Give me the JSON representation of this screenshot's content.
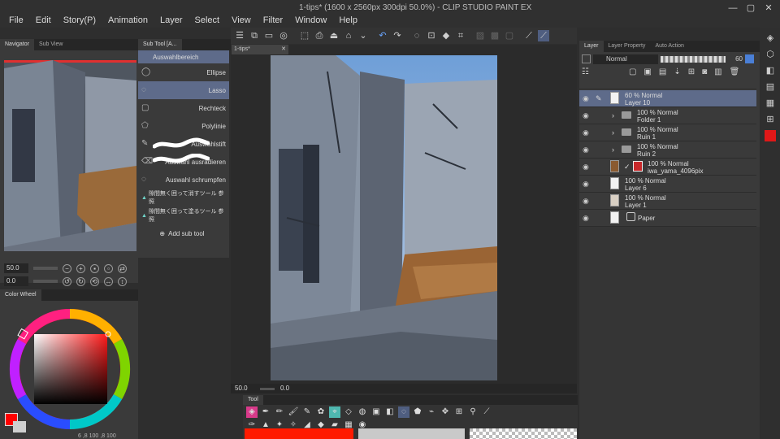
{
  "window": {
    "title": "1-tips* (1600 x 2560px 300dpi 50.0%) - CLIP STUDIO PAINT EX",
    "controls": [
      "—",
      "▢",
      "✕"
    ]
  },
  "menu": [
    "File",
    "Edit",
    "Story(P)",
    "Animation",
    "Layer",
    "Select",
    "View",
    "Filter",
    "Window",
    "Help"
  ],
  "navigator": {
    "tabs": [
      "Navigator",
      "Sub View"
    ],
    "zoom_value": "50.0",
    "rotate_value": "0.0"
  },
  "subtool": {
    "tab": "Sub Tool [A...",
    "header": "Auswahlbereich",
    "items": [
      {
        "label": "Ellipse",
        "icon": "ellipse-icon",
        "selected": false
      },
      {
        "label": "Lasso",
        "icon": "lasso-icon",
        "selected": true
      },
      {
        "label": "Rechteck",
        "icon": "rectangle-icon",
        "selected": false
      },
      {
        "label": "Polylinie",
        "icon": "polyline-icon",
        "selected": false
      },
      {
        "label": "Auswahlstift",
        "icon": "selection-pen-icon",
        "selected": false
      },
      {
        "label": "Auswahl ausradieren",
        "icon": "selection-eraser-icon",
        "selected": false
      },
      {
        "label": "Auswahl schrumpfen",
        "icon": "shrink-selection-icon",
        "selected": false
      },
      {
        "label": "隙間無く囲って消すツール 参照",
        "icon": "gap-fill-erase-icon",
        "selected": false
      },
      {
        "label": "隙間無く囲って塗るツール 参照",
        "icon": "gap-fill-paint-icon",
        "selected": false
      }
    ],
    "add_label": "Add sub tool"
  },
  "color_wheel": {
    "tab": "Color Wheel",
    "values": "6 ,8 100 ,8 100"
  },
  "document": {
    "tab": "1-tips*",
    "zoom_value": "50.0",
    "rotate_value": "0.0"
  },
  "tool_palette": {
    "tab": "Tool"
  },
  "layer_panel": {
    "tabs": [
      "Layer",
      "Layer Property",
      "Auto Action"
    ],
    "blend_mode": "Normal",
    "opacity": "60",
    "layers": [
      {
        "opacity_mode": "60 % Normal",
        "name": "Layer 10",
        "kind": "raster",
        "selected": true
      },
      {
        "opacity_mode": "100 % Normal",
        "name": "Folder 1",
        "kind": "folder",
        "selected": false
      },
      {
        "opacity_mode": "100 % Normal",
        "name": "Ruin 1",
        "kind": "folder",
        "selected": false
      },
      {
        "opacity_mode": "100 % Normal",
        "name": "Ruin 2",
        "kind": "folder",
        "selected": false
      },
      {
        "opacity_mode": "100 % Normal",
        "name": "iwa_yama_4096pix",
        "kind": "image",
        "selected": false
      },
      {
        "opacity_mode": "100 % Normal",
        "name": "Layer 6",
        "kind": "raster",
        "selected": false
      },
      {
        "opacity_mode": "100 % Normal",
        "name": "Layer 1",
        "kind": "raster",
        "selected": false
      },
      {
        "opacity_mode": "",
        "name": "Paper",
        "kind": "paper",
        "selected": false
      }
    ]
  },
  "colors": {
    "accent": "#5e6b8a",
    "main_color": "#ff0000",
    "sky": "#8ea4c4"
  }
}
